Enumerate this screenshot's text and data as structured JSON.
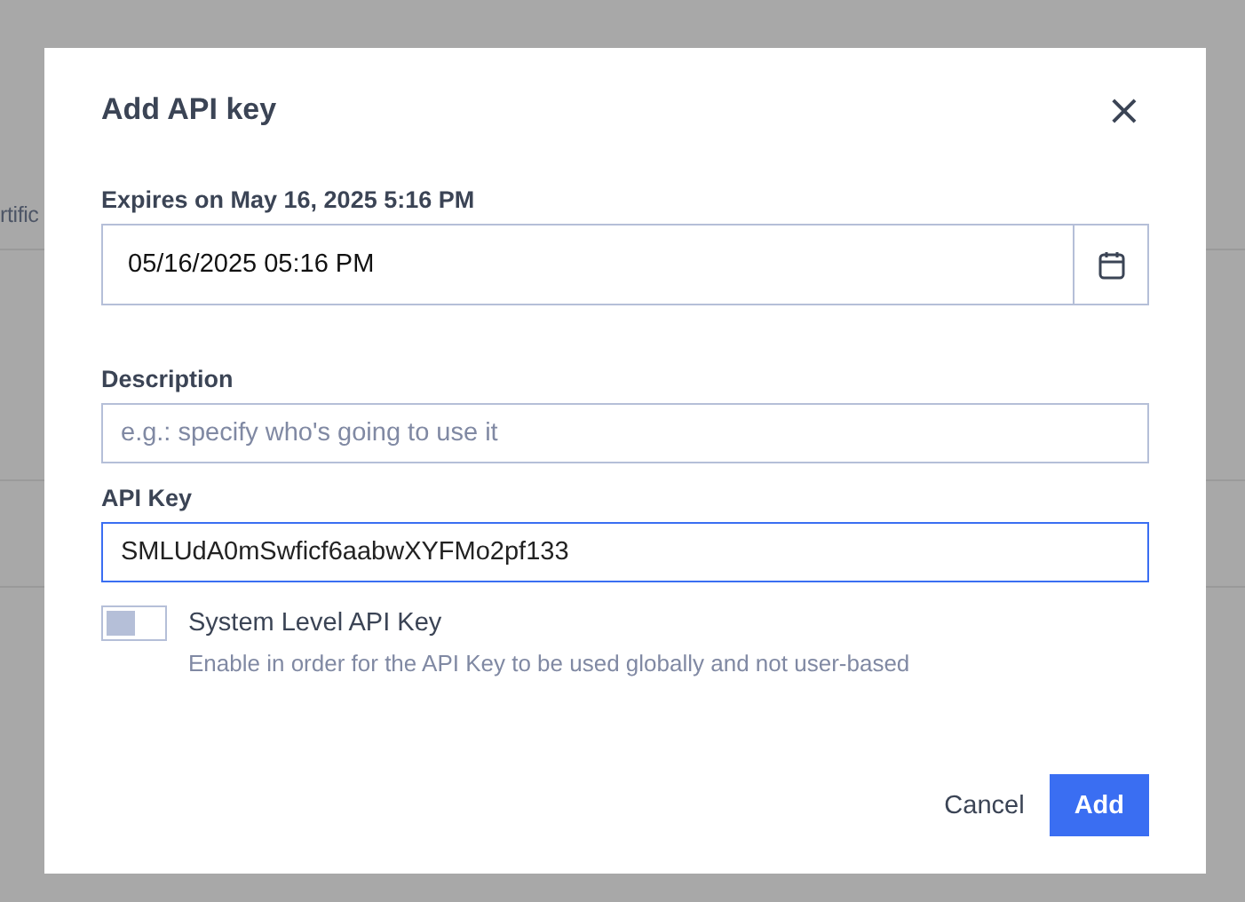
{
  "background": {
    "column_heading": "rtific"
  },
  "dialog": {
    "title": "Add API key",
    "close_icon": "×",
    "expires": {
      "label": "Expires on May 16, 2025 5:16 PM",
      "value": "05/16/2025 05:16 PM"
    },
    "description": {
      "label": "Description",
      "placeholder": "e.g.: specify who's going to use it"
    },
    "api_key": {
      "label": "API Key",
      "value": "SMLUdA0mSwficf6aabwXYFMo2pf133",
      "focused": true
    },
    "system_level": {
      "label": "System Level API Key",
      "hint": "Enable in order for the API Key to be used globally and not user-based",
      "checked": false
    },
    "buttons": [
      {
        "label": "Cancel",
        "kind": "text"
      },
      {
        "label": "Add",
        "kind": "primary"
      }
    ]
  }
}
